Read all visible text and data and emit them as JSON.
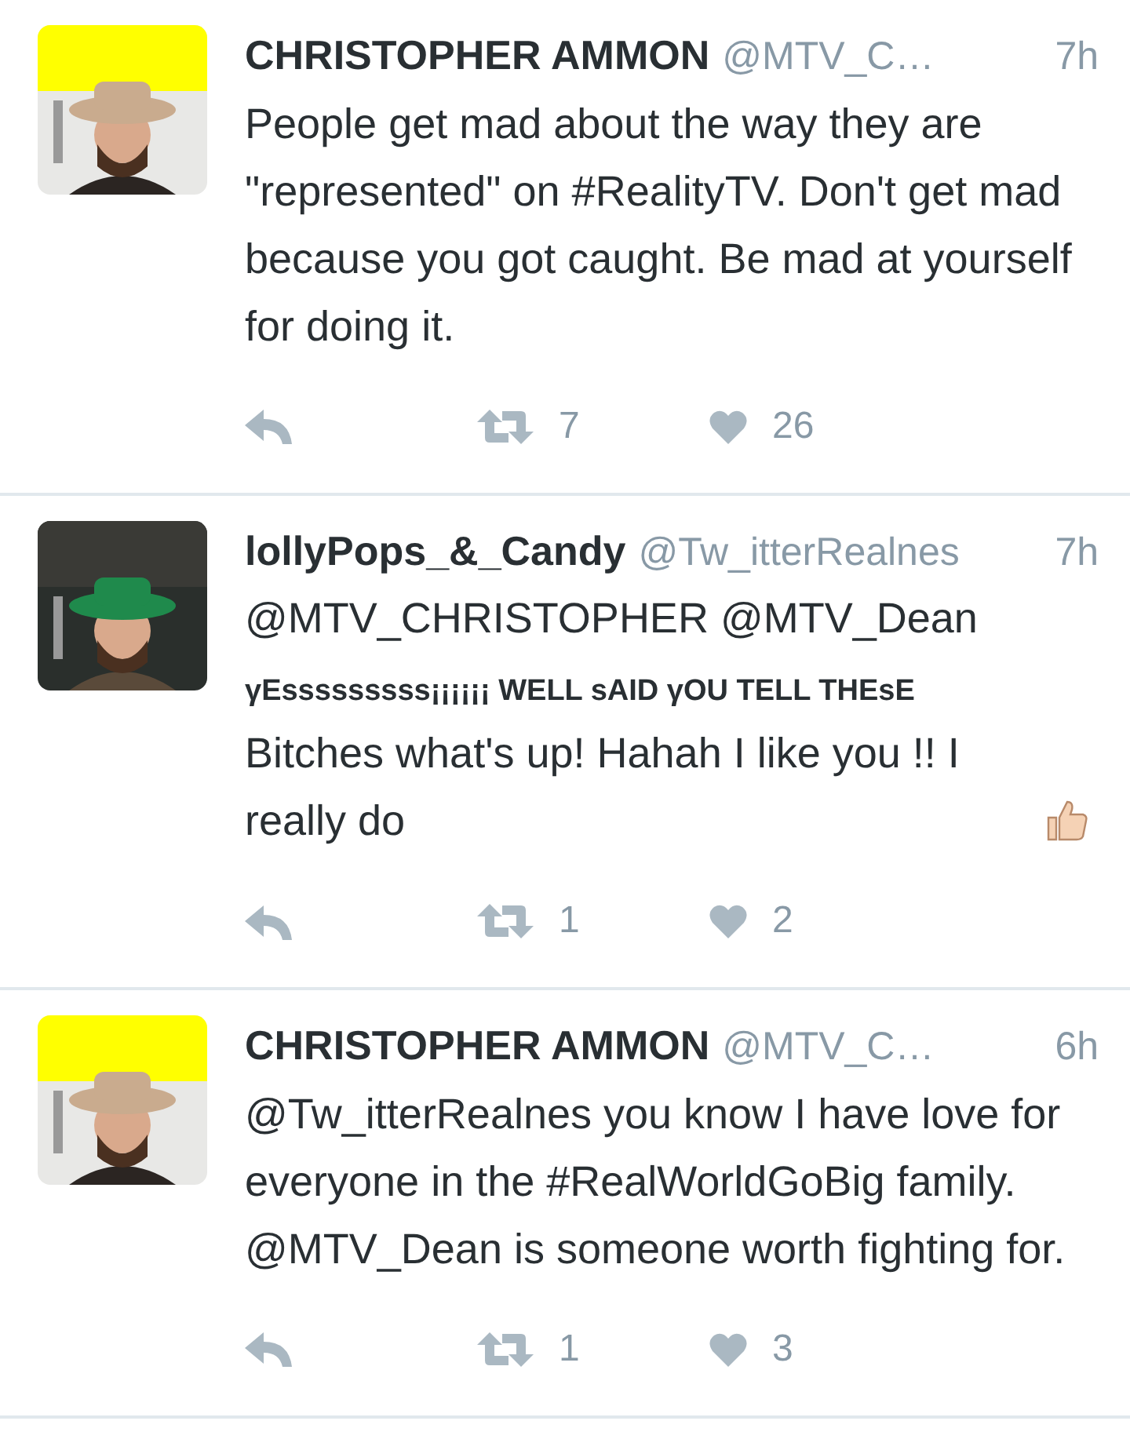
{
  "tweets": [
    {
      "name": "CHRISTOPHER AMMON",
      "handle": "@MTV_C…",
      "time": "7h",
      "text": "People get mad about the way they are \"represented\" on #RealityTV. Don't get mad because you got caught. Be mad at yourself for doing it.",
      "retweets": "7",
      "likes": "26"
    },
    {
      "name": "lollyPops_&_Candy",
      "handle": "@Tw_itterRealnes",
      "time": "7h",
      "text": "@MTV_CHRISTOPHER @MTV_Dean\n**γEsssssssss¡¡¡¡¡¡ WELL sAID γOU TELL THEsE**\nBitches what's up! Hahah I like you !! I really do",
      "thumbs_up": true,
      "retweets": "1",
      "likes": "2"
    },
    {
      "name": "CHRISTOPHER AMMON",
      "handle": "@MTV_C…",
      "time": "6h",
      "text": "@Tw_itterRealnes you know I have love for everyone in the #RealWorldGoBig family. @MTV_Dean is someone worth fighting for.",
      "retweets": "1",
      "likes": "3"
    }
  ]
}
